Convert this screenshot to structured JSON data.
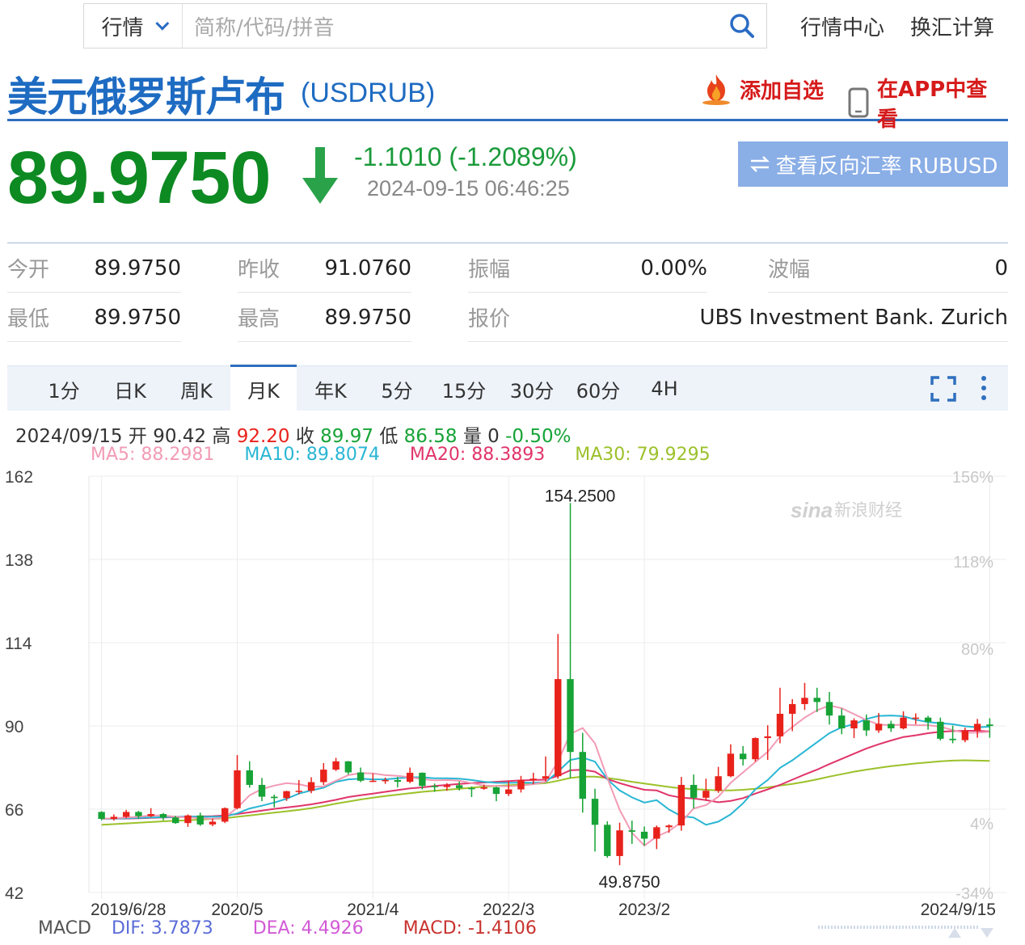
{
  "search": {
    "market_select": "行情",
    "placeholder": "简称/代码/拼音"
  },
  "nav_links": [
    "行情中心",
    "换汇计算"
  ],
  "title": {
    "name_cn": "美元俄罗斯卢布",
    "code": "(USDRUB)",
    "add_favorite": "添加自选",
    "view_in_app": "在APP中查看"
  },
  "quote": {
    "price": "89.9750",
    "change": "-1.1010 (-1.2089%)",
    "timestamp": "2024-09-15 06:46:25",
    "reverse_button": "查看反向汇率 RUBUSD",
    "direction": "down",
    "down_color": "#0d8a22"
  },
  "stats": [
    {
      "label": "今开",
      "value": "89.9750"
    },
    {
      "label": "昨收",
      "value": "91.0760"
    },
    {
      "label": "振幅",
      "value": "0.00%"
    },
    {
      "label": "波幅",
      "value": "0"
    },
    {
      "label": "最低",
      "value": "89.9750"
    },
    {
      "label": "最高",
      "value": "89.9750"
    },
    {
      "label": "报价",
      "value": "UBS Investment Bank. Zurich"
    }
  ],
  "tabs": [
    "1分",
    "日K",
    "周K",
    "月K",
    "年K",
    "5分",
    "15分",
    "30分",
    "60分",
    "4H"
  ],
  "active_tab": "月K",
  "ohlc": {
    "date": "2024/09/15",
    "open_label": "开",
    "open": "90.42",
    "high_label": "高",
    "high": "92.20",
    "close_label": "收",
    "close": "89.97",
    "low_label": "低",
    "low": "86.58",
    "vol_label": "量",
    "vol": "0",
    "pct": "-0.50%"
  },
  "ma": {
    "ma5": "MA5: 88.2981",
    "ma10": "MA10: 89.8074",
    "ma20": "MA20: 88.3893",
    "ma30": "MA30: 79.9295",
    "colors": {
      "ma5": "#f29bb5",
      "ma10": "#29b6d3",
      "ma20": "#e0356a",
      "ma30": "#9cc12a"
    }
  },
  "macd": {
    "label": "MACD",
    "dif": "DIF: 3.7873",
    "dea": "DEA: 4.4926",
    "macd": "MACD: -1.4106"
  },
  "chart_data": {
    "type": "candlestick",
    "watermark": "新浪财经",
    "y_ticks": [
      42,
      66,
      90,
      114,
      138,
      162
    ],
    "y_pct_ticks": [
      "-34%",
      "4%",
      "80%",
      "118%",
      "156%"
    ],
    "x_labels": [
      "2019/6/28",
      "2020/5",
      "2021/4",
      "2022/3",
      "2023/2",
      "2024/9/15"
    ],
    "ylim": [
      42,
      162
    ],
    "max_label": "154.2500",
    "min_label": "49.8750",
    "up_color": "#e8221b",
    "down_color": "#17a336",
    "candles": [
      [
        65.2,
        65.4,
        62.8,
        63.2
      ],
      [
        63.2,
        64.5,
        62.7,
        63.8
      ],
      [
        63.8,
        65.8,
        63.4,
        65.2
      ],
      [
        65.2,
        65.5,
        63.2,
        64.0
      ],
      [
        64.0,
        66.3,
        63.7,
        64.6
      ],
      [
        64.6,
        64.9,
        62.8,
        63.6
      ],
      [
        63.6,
        64.1,
        61.8,
        62.0
      ],
      [
        62.0,
        64.5,
        60.9,
        64.2
      ],
      [
        64.2,
        65.0,
        61.2,
        61.6
      ],
      [
        61.6,
        63.3,
        61.1,
        62.4
      ],
      [
        62.4,
        66.5,
        62.0,
        66.3
      ],
      [
        66.3,
        81.6,
        66.0,
        77.2
      ],
      [
        77.2,
        79.8,
        72.2,
        73.0
      ],
      [
        73.0,
        75.0,
        68.3,
        69.6
      ],
      [
        69.6,
        70.2,
        66.5,
        69.2
      ],
      [
        69.2,
        71.3,
        68.4,
        71.2
      ],
      [
        71.2,
        74.4,
        70.3,
        71.3
      ],
      [
        71.3,
        75.2,
        70.6,
        73.8
      ],
      [
        73.8,
        79.3,
        73.0,
        77.4
      ],
      [
        77.4,
        80.8,
        77.0,
        79.8
      ],
      [
        79.8,
        79.9,
        76.0,
        76.6
      ],
      [
        76.6,
        78.0,
        73.8,
        74.2
      ],
      [
        74.2,
        76.3,
        73.8,
        74.2
      ],
      [
        74.2,
        75.1,
        73.3,
        74.4
      ],
      [
        74.4,
        75.3,
        72.3,
        73.9
      ],
      [
        73.9,
        78.0,
        73.5,
        76.5
      ],
      [
        76.5,
        76.6,
        71.7,
        72.7
      ],
      [
        72.7,
        73.4,
        71.0,
        72.4
      ],
      [
        72.4,
        73.5,
        71.3,
        72.9
      ],
      [
        72.9,
        74.0,
        71.4,
        72.1
      ],
      [
        72.1,
        72.5,
        69.5,
        71.9
      ],
      [
        71.9,
        73.1,
        71.6,
        72.3
      ],
      [
        72.3,
        72.5,
        68.3,
        70.4
      ],
      [
        70.4,
        74.1,
        69.8,
        71.7
      ],
      [
        71.7,
        75.6,
        70.8,
        74.4
      ],
      [
        74.4,
        76.5,
        73.2,
        74.8
      ],
      [
        74.8,
        81.2,
        74.0,
        75.5
      ],
      [
        75.5,
        116.5,
        74.8,
        103.5
      ],
      [
        103.5,
        154.25,
        75.0,
        82.5
      ],
      [
        82.5,
        88.0,
        65.0,
        69.0
      ],
      [
        69.0,
        71.9,
        53.8,
        61.5
      ],
      [
        61.5,
        62.5,
        52.0,
        52.5
      ],
      [
        52.5,
        62.1,
        49.875,
        59.9
      ],
      [
        59.9,
        62.7,
        56.0,
        59.5
      ],
      [
        59.5,
        61.0,
        55.5,
        57.5
      ],
      [
        57.5,
        61.3,
        54.5,
        60.8
      ],
      [
        60.8,
        61.6,
        59.2,
        61.3
      ],
      [
        61.3,
        75.3,
        59.8,
        73.0
      ],
      [
        73.0,
        76.0,
        66.2,
        69.3
      ],
      [
        69.3,
        74.8,
        68.5,
        71.3
      ],
      [
        71.3,
        78.2,
        70.7,
        75.5
      ],
      [
        75.5,
        84.7,
        75.2,
        82.0
      ],
      [
        82.0,
        84.2,
        78.6,
        80.4
      ],
      [
        80.4,
        86.7,
        79.7,
        86.5
      ],
      [
        86.5,
        90.2,
        80.2,
        87.0
      ],
      [
        87.0,
        101.0,
        85.0,
        93.5
      ],
      [
        93.5,
        97.7,
        88.5,
        96.3
      ],
      [
        96.3,
        102.4,
        94.6,
        98.1
      ],
      [
        98.1,
        101.0,
        94.0,
        96.9
      ],
      [
        96.9,
        99.8,
        90.4,
        93.0
      ],
      [
        93.0,
        95.0,
        87.6,
        89.3
      ],
      [
        89.3,
        92.2,
        86.5,
        91.6
      ],
      [
        91.6,
        93.3,
        87.1,
        88.7
      ],
      [
        88.7,
        93.7,
        88.0,
        90.6
      ],
      [
        90.6,
        91.5,
        88.3,
        89.3
      ],
      [
        89.3,
        94.2,
        89.0,
        92.4
      ],
      [
        92.4,
        93.6,
        90.5,
        92.4
      ],
      [
        92.4,
        92.9,
        88.9,
        91.2
      ],
      [
        91.2,
        92.4,
        85.8,
        86.3
      ],
      [
        86.3,
        90.1,
        85.0,
        85.9
      ],
      [
        85.9,
        89.5,
        85.3,
        88.7
      ],
      [
        88.7,
        92.0,
        86.6,
        90.6
      ],
      [
        90.42,
        92.2,
        86.58,
        89.97
      ]
    ],
    "ma5": [
      63.2,
      63.4,
      63.6,
      63.8,
      64.2,
      64.2,
      63.8,
      63.6,
      63.4,
      63.2,
      63.6,
      66.4,
      70.0,
      71.8,
      72.8,
      73.5,
      73.2,
      72.4,
      72.6,
      74.2,
      75.8,
      76.4,
      76.3,
      75.8,
      75.6,
      75.2,
      74.7,
      74.3,
      74.4,
      74.2,
      73.5,
      72.8,
      72.7,
      72.6,
      72.8,
      73.2,
      73.9,
      79.8,
      87.7,
      89.4,
      85.0,
      75.0,
      65.8,
      59.2,
      55.5,
      58.1,
      59.7,
      62.3,
      66.2,
      67.2,
      69.6,
      73.6,
      76.6,
      79.6,
      82.5,
      86.9,
      89.7,
      92.4,
      94.5,
      95.9,
      95.1,
      93.4,
      91.7,
      90.4,
      90.2,
      90.4,
      90.2,
      90.2,
      89.8,
      88.8,
      88.0,
      88.1,
      88.3
    ],
    "ma10": [
      63.2,
      63.3,
      63.4,
      63.5,
      63.6,
      63.7,
      63.8,
      63.9,
      63.8,
      63.8,
      63.9,
      64.8,
      66.2,
      67.0,
      67.9,
      69.0,
      70.5,
      71.4,
      72.2,
      73.9,
      74.6,
      74.8,
      74.6,
      74.6,
      74.9,
      75.2,
      75.2,
      74.9,
      74.9,
      74.8,
      74.4,
      73.9,
      73.6,
      73.6,
      73.7,
      73.6,
      73.8,
      76.8,
      80.2,
      80.9,
      79.7,
      74.6,
      71.4,
      69.4,
      67.9,
      68.6,
      65.9,
      64.0,
      63.6,
      61.5,
      62.4,
      64.5,
      67.7,
      71.7,
      74.4,
      77.9,
      80.1,
      82.7,
      85.3,
      87.9,
      89.6,
      90.5,
      92.0,
      92.9,
      93.0,
      92.8,
      91.8,
      91.1,
      90.8,
      90.5,
      89.9,
      89.6,
      89.8
    ],
    "ma20": [
      63.2,
      63.3,
      63.3,
      63.4,
      63.5,
      63.6,
      63.7,
      63.8,
      63.9,
      64.0,
      64.2,
      64.6,
      65.1,
      65.6,
      66.1,
      66.5,
      66.9,
      67.4,
      68.0,
      68.7,
      69.5,
      70.0,
      70.5,
      71.0,
      71.5,
      72.0,
      72.3,
      72.7,
      73.0,
      73.3,
      73.5,
      73.7,
      73.9,
      74.1,
      74.3,
      74.4,
      74.5,
      75.6,
      77.2,
      77.4,
      76.8,
      74.7,
      73.5,
      72.5,
      71.6,
      71.4,
      70.0,
      69.3,
      69.1,
      68.6,
      68.0,
      68.4,
      69.2,
      70.5,
      71.7,
      73.0,
      74.5,
      76.0,
      77.4,
      79.0,
      80.5,
      82.0,
      83.5,
      84.7,
      85.8,
      86.8,
      87.3,
      87.9,
      88.3,
      88.5,
      88.6,
      88.6,
      88.4
    ],
    "ma30": [
      61.5,
      61.7,
      61.9,
      62.1,
      62.3,
      62.5,
      62.7,
      62.8,
      63.0,
      63.2,
      63.4,
      63.8,
      64.2,
      64.6,
      65.0,
      65.4,
      65.8,
      66.3,
      66.9,
      67.6,
      68.2,
      68.8,
      69.3,
      69.8,
      70.2,
      70.6,
      71.0,
      71.3,
      71.6,
      71.9,
      72.2,
      72.5,
      72.7,
      72.9,
      73.1,
      73.3,
      73.5,
      74.2,
      75.0,
      75.4,
      75.4,
      75.0,
      74.5,
      73.9,
      73.4,
      72.9,
      72.4,
      72.0,
      71.8,
      71.6,
      71.4,
      71.4,
      71.6,
      71.9,
      72.3,
      72.8,
      73.3,
      73.9,
      74.6,
      75.4,
      76.1,
      76.8,
      77.4,
      77.9,
      78.4,
      78.8,
      79.2,
      79.5,
      79.8,
      80.0,
      80.1,
      80.0,
      79.9
    ]
  }
}
